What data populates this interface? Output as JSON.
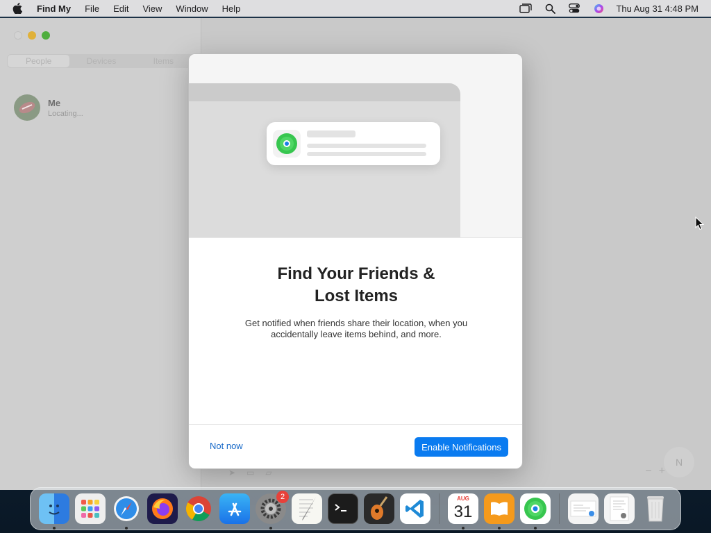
{
  "menubar": {
    "app_name": "Find My",
    "menus": [
      "File",
      "Edit",
      "View",
      "Window",
      "Help"
    ],
    "clock": "Thu Aug 31  4:48 PM",
    "status_icons": [
      "screen-mirroring-icon",
      "search-icon",
      "control-center-icon",
      "siri-icon"
    ]
  },
  "sidebar": {
    "segments": [
      "People",
      "Devices",
      "Items"
    ],
    "active_segment": "People",
    "people": [
      {
        "name": "Me",
        "status": "Locating..."
      }
    ]
  },
  "map": {
    "compass_label": "N",
    "zoom_out": "−",
    "zoom_in": "+"
  },
  "modal": {
    "title_line1": "Find Your Friends &",
    "title_line2": "Lost Items",
    "body": "Get notified when friends share their location, when you accidentally leave items behind, and more.",
    "secondary_button": "Not now",
    "primary_button": "Enable Notifications",
    "accent_color": "#0a7bf0"
  },
  "dock": {
    "apps": [
      "Finder",
      "Launchpad",
      "Safari",
      "Firefox",
      "Chrome",
      "App Store",
      "System Settings",
      "TextEdit",
      "Terminal",
      "GarageBand",
      "Visual Studio Code",
      "Calendar",
      "Books",
      "Find My"
    ],
    "system_settings_badge": "2",
    "calendar_month": "AUG",
    "calendar_day": "31"
  }
}
